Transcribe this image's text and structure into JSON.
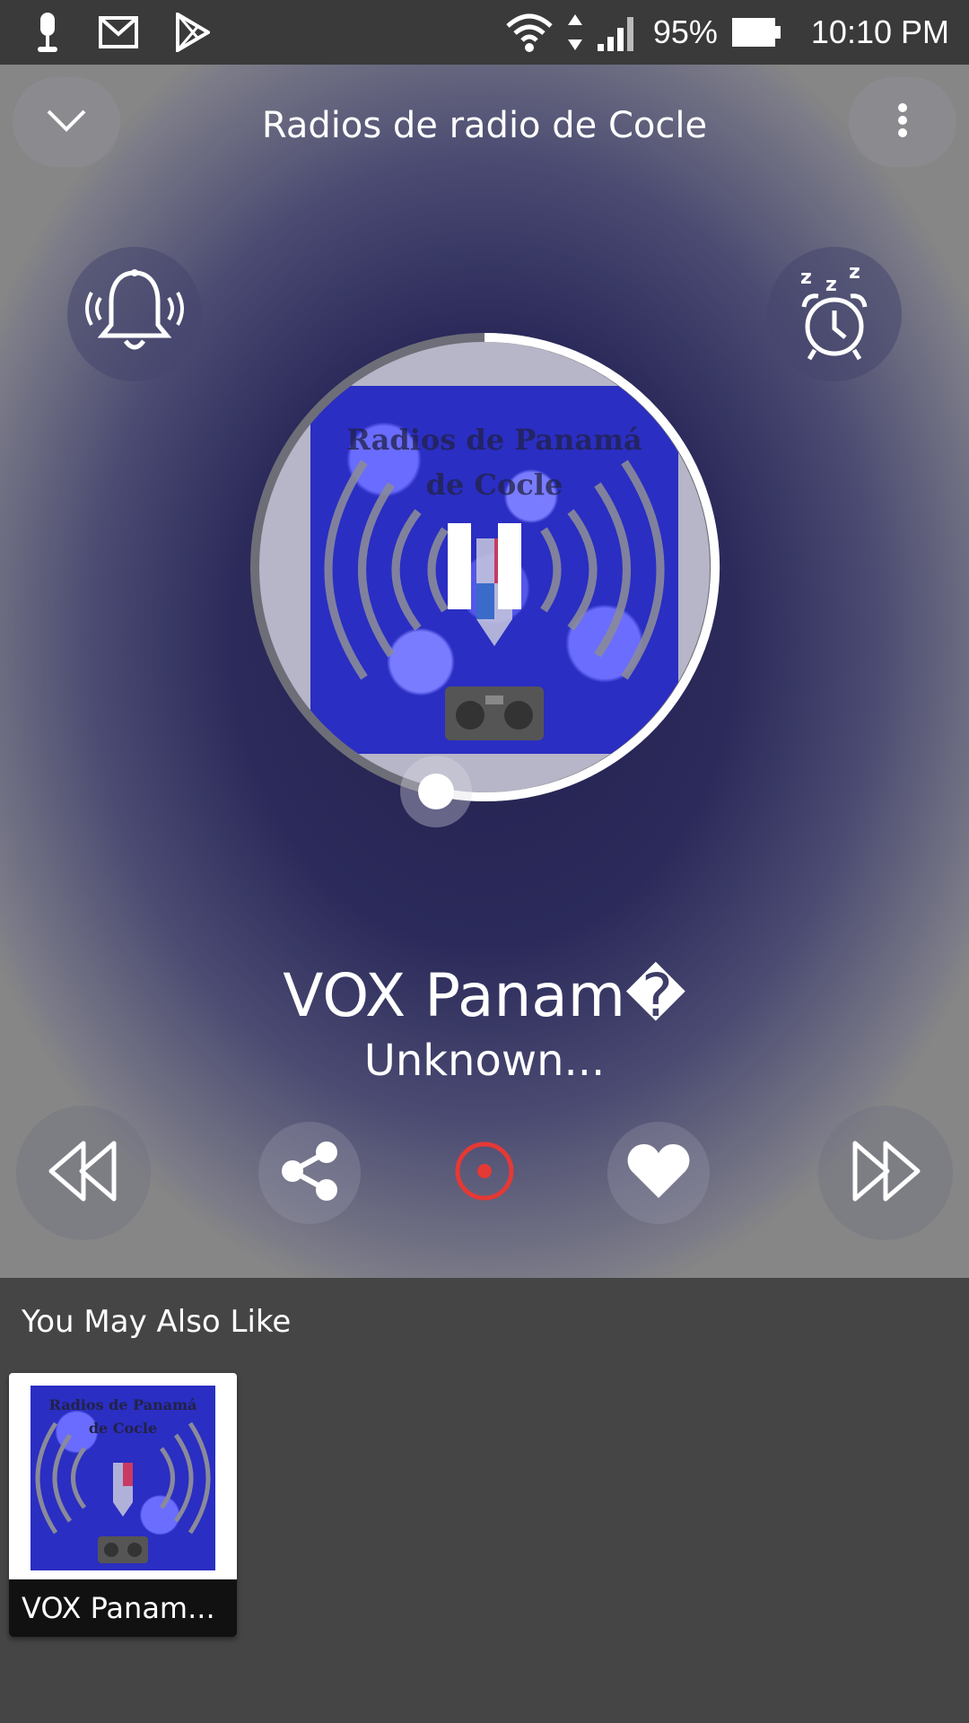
{
  "status_bar": {
    "battery": "95%",
    "time": "10:10 PM",
    "icons": [
      "microphone-icon",
      "gmail-icon",
      "play-store-icon",
      "wifi-icon",
      "cell-signal-icon",
      "battery-icon"
    ]
  },
  "player": {
    "title": "Radios de radio de Cocle",
    "artwork_text_line1": "Radios de Panamá",
    "artwork_text_line2": "de Cocle",
    "station_name": "VOX Panam�",
    "subtitle": "Unknown...",
    "record_color": "#e53935",
    "icons": [
      "chevron-down-icon",
      "more-vert-icon",
      "bell-icon",
      "sleep-alarm-icon",
      "pause-icon",
      "rewind-icon",
      "share-icon",
      "record-icon",
      "heart-icon",
      "fast-forward-icon"
    ]
  },
  "recommendations": {
    "heading": "You May Also Like",
    "items": [
      {
        "label": "VOX Panam...",
        "artwork_text_line1": "Radios de Panamá",
        "artwork_text_line2": "de Cocle"
      }
    ]
  }
}
